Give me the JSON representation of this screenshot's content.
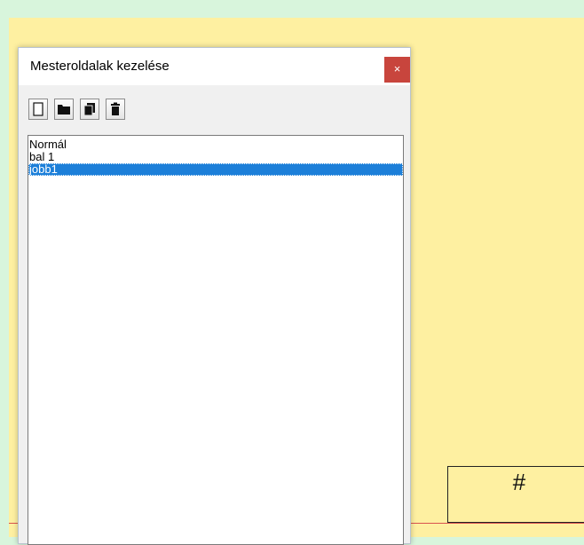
{
  "document": {
    "footer_field": "#"
  },
  "dialog": {
    "title": "Mesteroldalak kezelése",
    "close_glyph": "×",
    "toolbar": [
      {
        "icon": "new-page-icon"
      },
      {
        "icon": "folder-icon"
      },
      {
        "icon": "copy-pages-icon"
      },
      {
        "icon": "trash-icon"
      }
    ],
    "list": {
      "items": [
        "Normál",
        "bal 1",
        "jobb1"
      ],
      "selected_index": 2
    }
  },
  "colors": {
    "background": "#d8f5dc",
    "page": "#fef0a1",
    "close_button": "#c8453d",
    "selection": "#1c7fd9"
  }
}
